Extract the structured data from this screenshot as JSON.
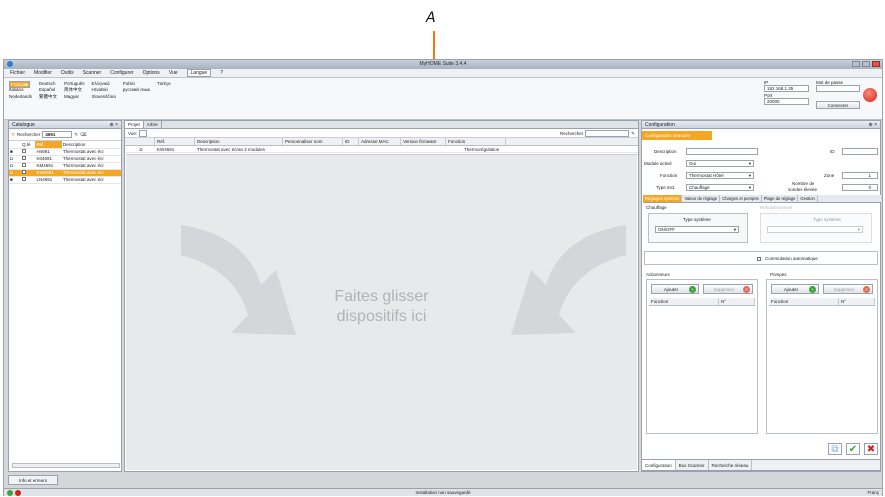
{
  "annotation": {
    "letter": "A"
  },
  "window": {
    "title": "MyHOME Suite 3.4.4"
  },
  "menu": [
    "Fichier",
    "Modifier",
    "Outils",
    "Scanner",
    "Configurer",
    "Options",
    "Vue",
    "Langue",
    "?"
  ],
  "languages": [
    "English",
    "Deutsch",
    "Português",
    "Ελληνικά",
    "Polski",
    "Türkçe",
    "Italiano",
    "Español",
    "简体中文",
    "Hrvatski",
    "русский язык",
    "",
    "Français",
    "Nederlands",
    "繁體中文",
    "Magyar",
    "Slovenščina",
    ""
  ],
  "connection": {
    "ip_label": "IP",
    "ip_value": "192.168.1.35",
    "port_label": "Port",
    "port_value": "20000",
    "password_label": "Mot de passe",
    "connect_label": "Connecter"
  },
  "catalog": {
    "title": "Catalogue",
    "search_label": "Rechercher",
    "search_value": "4691",
    "columns": [
      "Q.té",
      "Réf.",
      "Description"
    ],
    "rows": [
      {
        "ref": "H4691",
        "desc": "Thermostat avec écr",
        "hl": false
      },
      {
        "ref": "K04691",
        "desc": "Thermostat avec écr",
        "hl": false
      },
      {
        "ref": "KM4691",
        "desc": "Thermostat avec écr",
        "hl": false
      },
      {
        "ref": "KW4691",
        "desc": "Thermostat avec écr",
        "hl": true
      },
      {
        "ref": "LN4691",
        "desc": "Thermostat avec écr",
        "hl": false
      }
    ],
    "info_tab": "Info et erreurs"
  },
  "project": {
    "tabs": [
      "Projet",
      "Arbre"
    ],
    "view_label": "Vue:",
    "search_label": "Rechercher",
    "columns": [
      "Réf.",
      "Description",
      "Personnaliser nom",
      "ID",
      "Adresse MAC",
      "Version firmware",
      "Fonction"
    ],
    "row": {
      "ref": "KW4691",
      "desc": "Thermostat avec écran 2 modules",
      "fonction": "Thermorégulation"
    },
    "drop_line1": "Faites glisser",
    "drop_line2": "dispositifs ici"
  },
  "config": {
    "title": "Configuration",
    "subtab": "Configuration avancée",
    "description_label": "Description",
    "id_label": "ID",
    "module_label": "Module activé",
    "module_value": "Oui",
    "function_label": "Fonction",
    "function_value": "Thermostat Hôtel",
    "zone_label": "Zone",
    "zone_value": "1",
    "type_label": "Type inst.",
    "type_value": "Chauffage",
    "probes_label": "Nombre de",
    "probes_label2": "sondes élevée",
    "probes_value": "0",
    "tabs": [
      "Réglages système",
      "Valeur de réglage",
      "Charges et pompes",
      "Plage de réglage",
      "Gestion"
    ],
    "chauffage_label": "Chauffage",
    "refroid_label": "Refroidissement",
    "type_sys_label": "Type système",
    "type_sys_value": "ON/OFF",
    "type_sys_label2": "Type système",
    "auto_switch": "Commutation automatique",
    "actuators_label": "Actionneurs",
    "pumps_label": "Pompes",
    "add_label": "Ajouter",
    "remove_label": "Supprimer",
    "col_fonction": "Fonction",
    "col_num": "N°",
    "bottom_tabs": [
      "Configuration",
      "Bus Scanner",
      "Recherche réseau"
    ]
  },
  "status": {
    "text": "Installation non sauvegardé",
    "lang": "Franç"
  }
}
